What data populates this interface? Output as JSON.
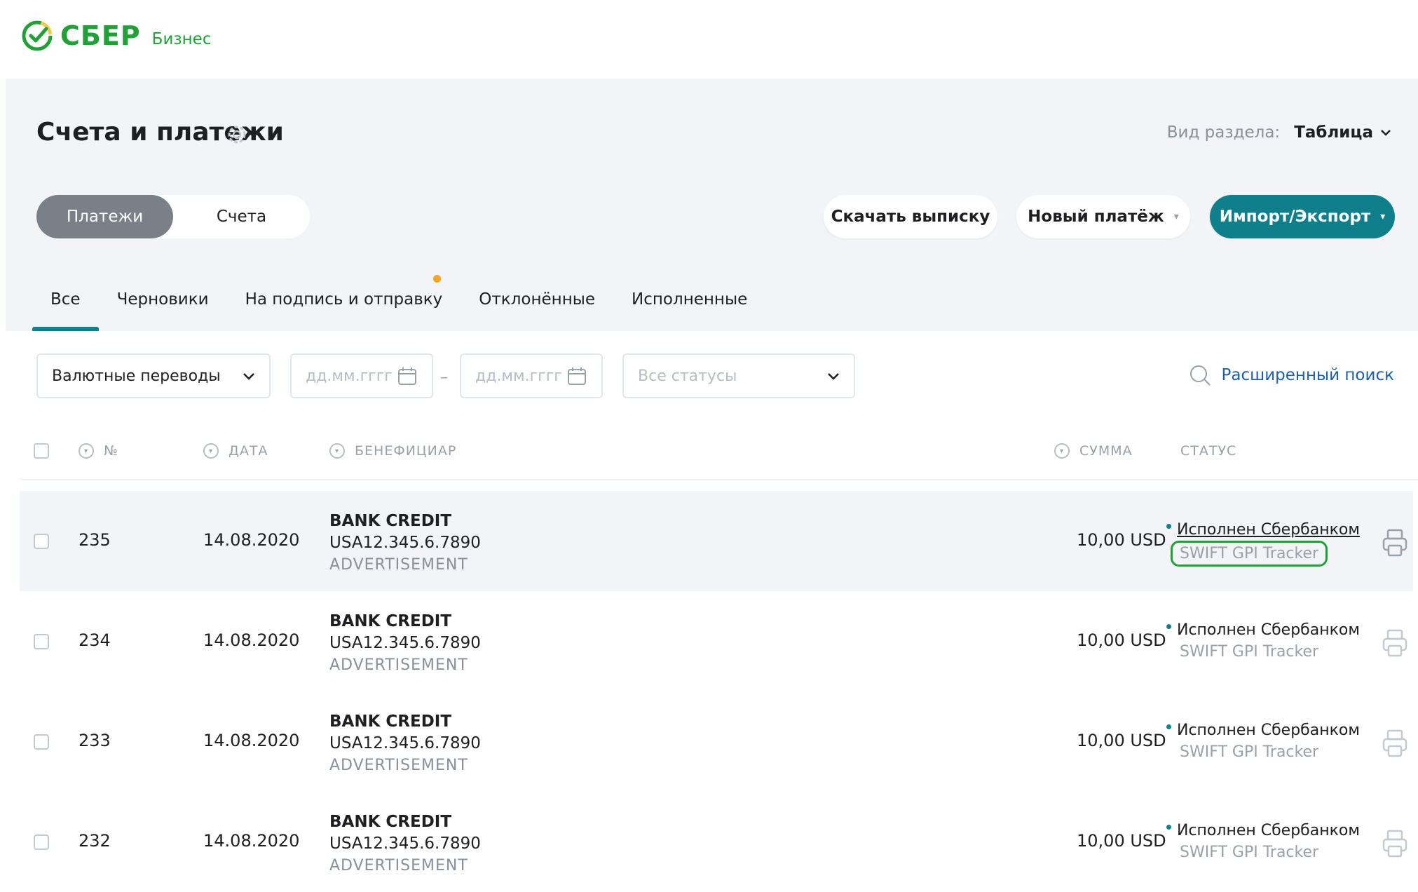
{
  "brand": {
    "name": "СБЕР",
    "sub": "Бизнес",
    "color": "#21a038"
  },
  "page": {
    "title": "Счета и платежи",
    "view_label": "Вид раздела:",
    "view_value": "Таблица"
  },
  "segments": [
    "Платежи",
    "Счета"
  ],
  "actions": {
    "download": "Скачать выписку",
    "new_payment": "Новый платёж",
    "import_export": "Импорт/Экспорт",
    "accent": "#107f8c"
  },
  "tabs": [
    "Все",
    "Черновики",
    "На подпись и отправку",
    "Отклонённые",
    "Исполненные"
  ],
  "filters": {
    "type_value": "Валютные переводы",
    "date_from_placeholder": "дд.мм.гггг",
    "date_to_placeholder": "дд.мм.гггг",
    "date_separator": "–",
    "status_placeholder": "Все статусы",
    "advanced_search": "Расширенный поиск"
  },
  "table": {
    "headers": {
      "num": "№",
      "date": "ДАТА",
      "beneficiary": "БЕНЕФИЦИАР",
      "amount": "СУММА",
      "status": "СТАТУС"
    },
    "rows": [
      {
        "num": "235",
        "date": "14.08.2020",
        "name": "BANK CREDIT",
        "account": "USA12.345.6.7890",
        "purpose": "ADVERTISEMENT",
        "amount": "10,00 USD",
        "status": "Исполнен Сбербанком",
        "tracker": "SWIFT GPI Tracker"
      },
      {
        "num": "234",
        "date": "14.08.2020",
        "name": "BANK CREDIT",
        "account": "USA12.345.6.7890",
        "purpose": "ADVERTISEMENT",
        "amount": "10,00 USD",
        "status": "Исполнен Сбербанком",
        "tracker": "SWIFT GPI Tracker"
      },
      {
        "num": "233",
        "date": "14.08.2020",
        "name": "BANK CREDIT",
        "account": "USA12.345.6.7890",
        "purpose": "ADVERTISEMENT",
        "amount": "10,00 USD",
        "status": "Исполнен Сбербанком",
        "tracker": "SWIFT GPI Tracker"
      },
      {
        "num": "232",
        "date": "14.08.2020",
        "name": "BANK CREDIT",
        "account": "USA12.345.6.7890",
        "purpose": "ADVERTISEMENT",
        "amount": "10,00 USD",
        "status": "Исполнен Сбербанком",
        "tracker": "SWIFT GPI Tracker"
      }
    ]
  }
}
